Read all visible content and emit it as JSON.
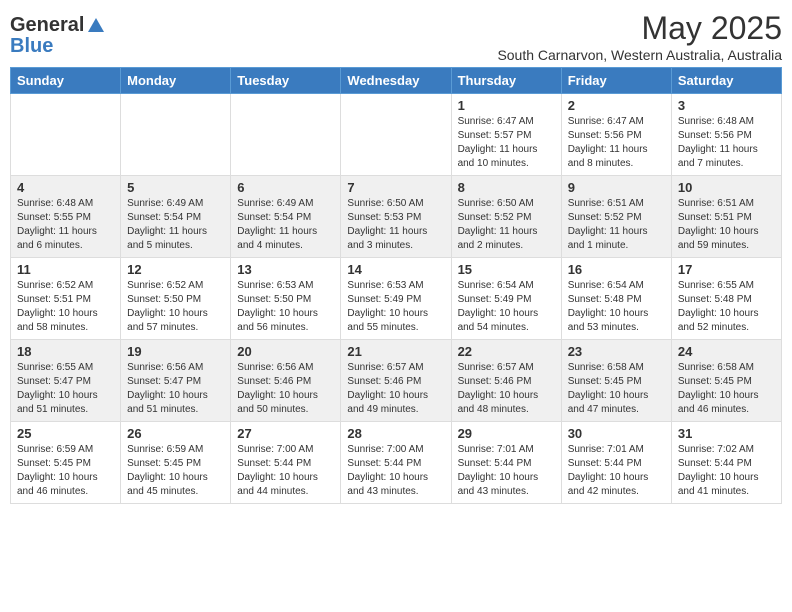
{
  "header": {
    "logo_general": "General",
    "logo_blue": "Blue",
    "main_title": "May 2025",
    "subtitle": "South Carnarvon, Western Australia, Australia"
  },
  "weekdays": [
    "Sunday",
    "Monday",
    "Tuesday",
    "Wednesday",
    "Thursday",
    "Friday",
    "Saturday"
  ],
  "weeks": [
    {
      "days": [
        {
          "number": "",
          "info": ""
        },
        {
          "number": "",
          "info": ""
        },
        {
          "number": "",
          "info": ""
        },
        {
          "number": "",
          "info": ""
        },
        {
          "number": "1",
          "info": "Sunrise: 6:47 AM\nSunset: 5:57 PM\nDaylight: 11 hours\nand 10 minutes."
        },
        {
          "number": "2",
          "info": "Sunrise: 6:47 AM\nSunset: 5:56 PM\nDaylight: 11 hours\nand 8 minutes."
        },
        {
          "number": "3",
          "info": "Sunrise: 6:48 AM\nSunset: 5:56 PM\nDaylight: 11 hours\nand 7 minutes."
        }
      ]
    },
    {
      "days": [
        {
          "number": "4",
          "info": "Sunrise: 6:48 AM\nSunset: 5:55 PM\nDaylight: 11 hours\nand 6 minutes."
        },
        {
          "number": "5",
          "info": "Sunrise: 6:49 AM\nSunset: 5:54 PM\nDaylight: 11 hours\nand 5 minutes."
        },
        {
          "number": "6",
          "info": "Sunrise: 6:49 AM\nSunset: 5:54 PM\nDaylight: 11 hours\nand 4 minutes."
        },
        {
          "number": "7",
          "info": "Sunrise: 6:50 AM\nSunset: 5:53 PM\nDaylight: 11 hours\nand 3 minutes."
        },
        {
          "number": "8",
          "info": "Sunrise: 6:50 AM\nSunset: 5:52 PM\nDaylight: 11 hours\nand 2 minutes."
        },
        {
          "number": "9",
          "info": "Sunrise: 6:51 AM\nSunset: 5:52 PM\nDaylight: 11 hours\nand 1 minute."
        },
        {
          "number": "10",
          "info": "Sunrise: 6:51 AM\nSunset: 5:51 PM\nDaylight: 10 hours\nand 59 minutes."
        }
      ]
    },
    {
      "days": [
        {
          "number": "11",
          "info": "Sunrise: 6:52 AM\nSunset: 5:51 PM\nDaylight: 10 hours\nand 58 minutes."
        },
        {
          "number": "12",
          "info": "Sunrise: 6:52 AM\nSunset: 5:50 PM\nDaylight: 10 hours\nand 57 minutes."
        },
        {
          "number": "13",
          "info": "Sunrise: 6:53 AM\nSunset: 5:50 PM\nDaylight: 10 hours\nand 56 minutes."
        },
        {
          "number": "14",
          "info": "Sunrise: 6:53 AM\nSunset: 5:49 PM\nDaylight: 10 hours\nand 55 minutes."
        },
        {
          "number": "15",
          "info": "Sunrise: 6:54 AM\nSunset: 5:49 PM\nDaylight: 10 hours\nand 54 minutes."
        },
        {
          "number": "16",
          "info": "Sunrise: 6:54 AM\nSunset: 5:48 PM\nDaylight: 10 hours\nand 53 minutes."
        },
        {
          "number": "17",
          "info": "Sunrise: 6:55 AM\nSunset: 5:48 PM\nDaylight: 10 hours\nand 52 minutes."
        }
      ]
    },
    {
      "days": [
        {
          "number": "18",
          "info": "Sunrise: 6:55 AM\nSunset: 5:47 PM\nDaylight: 10 hours\nand 51 minutes."
        },
        {
          "number": "19",
          "info": "Sunrise: 6:56 AM\nSunset: 5:47 PM\nDaylight: 10 hours\nand 51 minutes."
        },
        {
          "number": "20",
          "info": "Sunrise: 6:56 AM\nSunset: 5:46 PM\nDaylight: 10 hours\nand 50 minutes."
        },
        {
          "number": "21",
          "info": "Sunrise: 6:57 AM\nSunset: 5:46 PM\nDaylight: 10 hours\nand 49 minutes."
        },
        {
          "number": "22",
          "info": "Sunrise: 6:57 AM\nSunset: 5:46 PM\nDaylight: 10 hours\nand 48 minutes."
        },
        {
          "number": "23",
          "info": "Sunrise: 6:58 AM\nSunset: 5:45 PM\nDaylight: 10 hours\nand 47 minutes."
        },
        {
          "number": "24",
          "info": "Sunrise: 6:58 AM\nSunset: 5:45 PM\nDaylight: 10 hours\nand 46 minutes."
        }
      ]
    },
    {
      "days": [
        {
          "number": "25",
          "info": "Sunrise: 6:59 AM\nSunset: 5:45 PM\nDaylight: 10 hours\nand 46 minutes."
        },
        {
          "number": "26",
          "info": "Sunrise: 6:59 AM\nSunset: 5:45 PM\nDaylight: 10 hours\nand 45 minutes."
        },
        {
          "number": "27",
          "info": "Sunrise: 7:00 AM\nSunset: 5:44 PM\nDaylight: 10 hours\nand 44 minutes."
        },
        {
          "number": "28",
          "info": "Sunrise: 7:00 AM\nSunset: 5:44 PM\nDaylight: 10 hours\nand 43 minutes."
        },
        {
          "number": "29",
          "info": "Sunrise: 7:01 AM\nSunset: 5:44 PM\nDaylight: 10 hours\nand 43 minutes."
        },
        {
          "number": "30",
          "info": "Sunrise: 7:01 AM\nSunset: 5:44 PM\nDaylight: 10 hours\nand 42 minutes."
        },
        {
          "number": "31",
          "info": "Sunrise: 7:02 AM\nSunset: 5:44 PM\nDaylight: 10 hours\nand 41 minutes."
        }
      ]
    }
  ]
}
